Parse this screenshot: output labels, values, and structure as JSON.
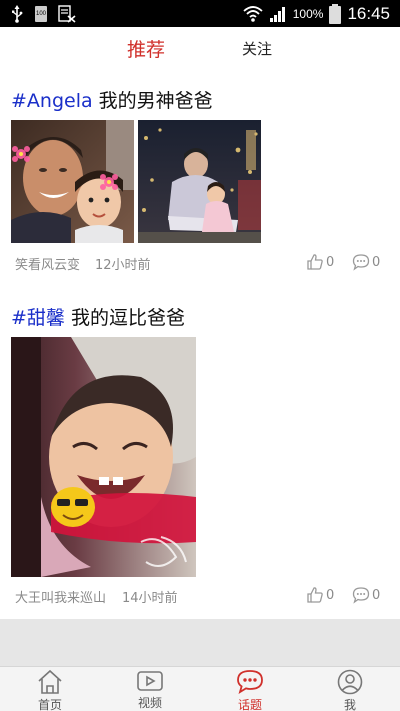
{
  "status_bar": {
    "icons": [
      "usb-icon",
      "sd-card-icon",
      "no-sd-icon",
      "wifi-icon",
      "signal-icon",
      "battery-icon"
    ],
    "sd_label": "100",
    "battery_pct": "100%",
    "time": "16:45"
  },
  "tabs": {
    "recommend": "推荐",
    "follow": "关注",
    "active": "recommend",
    "active_color": "#d0302b"
  },
  "posts": [
    {
      "hashtag": "#Angela",
      "title": " 我的男神爸爸",
      "author": "笑看风云变",
      "time": "12小时前",
      "likes": "0",
      "comments": "0"
    },
    {
      "hashtag": "#甜馨",
      "title": " 我的逗比爸爸",
      "author": "大王叫我来巡山",
      "time": "14小时前",
      "likes": "0",
      "comments": "0"
    }
  ],
  "bottom_nav": {
    "items": [
      {
        "label": "首页",
        "icon": "home-icon"
      },
      {
        "label": "视频",
        "icon": "video-icon"
      },
      {
        "label": "话题",
        "icon": "topic-chat-icon"
      },
      {
        "label": "我",
        "icon": "profile-icon"
      }
    ],
    "active": "话题"
  },
  "colors": {
    "accent": "#d0302b",
    "hashtag": "#1a2fc9",
    "meta": "#8a8a8a"
  }
}
